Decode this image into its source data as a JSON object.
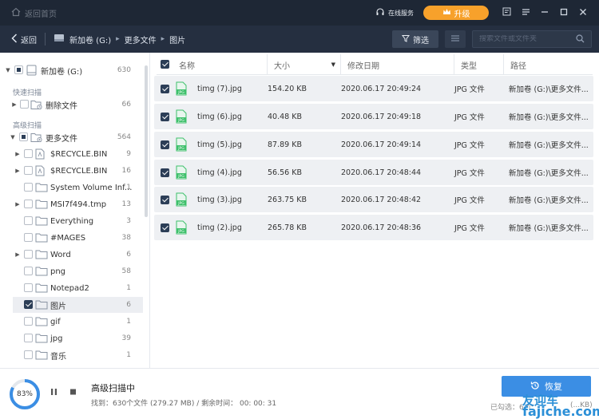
{
  "titlebar": {
    "home_label": "返回首页",
    "online_label": "在线服务",
    "upgrade_label": "升级"
  },
  "navbar": {
    "back_label": "返回",
    "crumbs": [
      "新加卷 (G:)",
      "更多文件",
      "图片"
    ],
    "filter_label": "筛选",
    "search_placeholder": "搜索文件或文件夹"
  },
  "sidebar": {
    "root": {
      "label": "新加卷 (G:)",
      "count": "630"
    },
    "quick_scan_label": "快速扫描",
    "deleted": {
      "label": "删除文件",
      "count": "66"
    },
    "advanced_scan_label": "高级扫描",
    "more_files": {
      "label": "更多文件",
      "count": "564"
    },
    "folders": [
      {
        "label": "$RECYCLE.BIN",
        "count": "9"
      },
      {
        "label": "$RECYCLE.BIN",
        "count": "16"
      },
      {
        "label": "System Volume Inf...",
        "count": "1"
      },
      {
        "label": "MSI7f494.tmp",
        "count": "13"
      },
      {
        "label": "Everything",
        "count": "3"
      },
      {
        "label": "#MAGES",
        "count": "38"
      },
      {
        "label": "Word",
        "count": "6"
      },
      {
        "label": "png",
        "count": "58"
      },
      {
        "label": "Notepad2",
        "count": "1"
      },
      {
        "label": "图片",
        "count": "6"
      },
      {
        "label": "gif",
        "count": "1"
      },
      {
        "label": "jpg",
        "count": "39"
      },
      {
        "label": "音乐",
        "count": "1"
      }
    ]
  },
  "table": {
    "headers": [
      "名称",
      "大小",
      "修改日期",
      "类型",
      "路径"
    ],
    "rows": [
      {
        "name": "timg (7).jpg",
        "size": "154.20 KB",
        "date": "2020.06.17 20:49:24",
        "type": "JPG 文件",
        "path": "新加卷 (G:)\\更多文件..."
      },
      {
        "name": "timg (6).jpg",
        "size": "40.48 KB",
        "date": "2020.06.17 20:49:18",
        "type": "JPG 文件",
        "path": "新加卷 (G:)\\更多文件..."
      },
      {
        "name": "timg (5).jpg",
        "size": "87.89 KB",
        "date": "2020.06.17 20:49:14",
        "type": "JPG 文件",
        "path": "新加卷 (G:)\\更多文件..."
      },
      {
        "name": "timg (4).jpg",
        "size": "56.56 KB",
        "date": "2020.06.17 20:48:44",
        "type": "JPG 文件",
        "path": "新加卷 (G:)\\更多文件..."
      },
      {
        "name": "timg (3).jpg",
        "size": "263.75 KB",
        "date": "2020.06.17 20:48:42",
        "type": "JPG 文件",
        "path": "新加卷 (G:)\\更多文件..."
      },
      {
        "name": "timg (2).jpg",
        "size": "265.78 KB",
        "date": "2020.06.17 20:48:36",
        "type": "JPG 文件",
        "path": "新加卷 (G:)\\更多文件..."
      }
    ]
  },
  "bottom": {
    "progress_percent": "83%",
    "progress_value": 83,
    "scan_title": "高级扫描中",
    "scan_info": "找到：630个文件 (279.27 MB) / 剩余时间：  00: 00: 31",
    "recover_label": "恢复",
    "selected_info": "已勾选：6 个",
    "selected_size": "(...KB)",
    "watermark_line1": "友迎车",
    "watermark_line2": "fajiche.com"
  },
  "colors": {
    "titlebar": "#1e2735",
    "navbar": "#252f40",
    "upgrade": "#f7a12b",
    "recover": "#3b8ee4",
    "progress": "#3b8ee4",
    "jpg_icon": "#3ec06b"
  }
}
